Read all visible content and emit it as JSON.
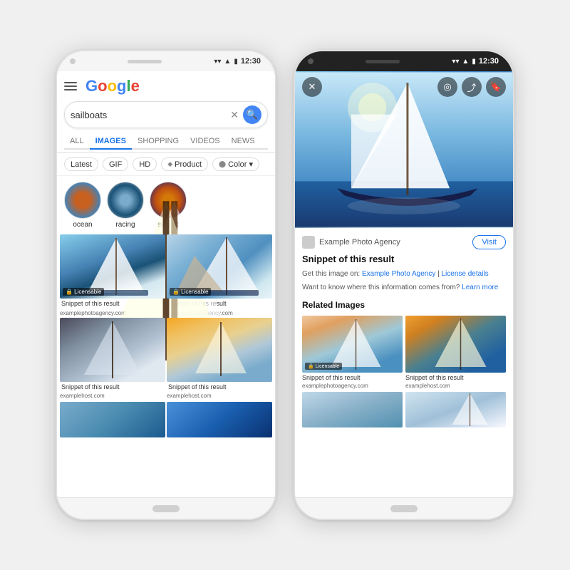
{
  "phones": {
    "left": {
      "time": "12:30",
      "search": {
        "query": "sailboats",
        "placeholder": "sailboats"
      },
      "nav_tabs": [
        {
          "label": "ALL",
          "active": false
        },
        {
          "label": "IMAGES",
          "active": true
        },
        {
          "label": "SHOPPING",
          "active": false
        },
        {
          "label": "VIDEOS",
          "active": false
        },
        {
          "label": "NEWS",
          "active": false
        }
      ],
      "filters": [
        {
          "label": "Latest"
        },
        {
          "label": "GIF"
        },
        {
          "label": "HD"
        },
        {
          "label": "Product"
        },
        {
          "label": "Color ▾"
        }
      ],
      "circles": [
        {
          "label": "ocean"
        },
        {
          "label": "racing"
        },
        {
          "label": "sunset"
        }
      ],
      "grid_items": [
        {
          "snippet": "Snippet of this result",
          "host": "examplephotoagency.com",
          "licensable": true
        },
        {
          "snippet": "Snippet of this result",
          "host": "examplephotoagency.com",
          "licensable": true
        },
        {
          "snippet": "Snippet of this result",
          "host": "examplehost.com",
          "licensable": false
        },
        {
          "snippet": "Snippet of this result",
          "host": "examplehost.com",
          "licensable": false
        }
      ]
    },
    "right": {
      "time": "12:30",
      "detail": {
        "source_name": "Example Photo Agency",
        "visit_label": "Visit",
        "title": "Snippet of this result",
        "desc_line1": "Get this image on: Example Photo Agency | License details",
        "desc_line2": "Want to know where this information comes from? Learn more",
        "related_title": "Related Images",
        "related_items": [
          {
            "snippet": "Snippet of this result",
            "host": "examplephotoagency.com",
            "licensable": true
          },
          {
            "snippet": "Snippet of this result",
            "host": "examplehost.com",
            "licensable": false
          },
          {
            "snippet": "",
            "host": "",
            "licensable": false
          },
          {
            "snippet": "",
            "host": "",
            "licensable": false
          }
        ]
      }
    }
  },
  "icons": {
    "close": "✕",
    "search": "🔍",
    "share": "⤴",
    "bookmark": "🔖",
    "lens": "◎",
    "hamburger": "☰",
    "diamond": "◆",
    "licensable": "🔒"
  }
}
